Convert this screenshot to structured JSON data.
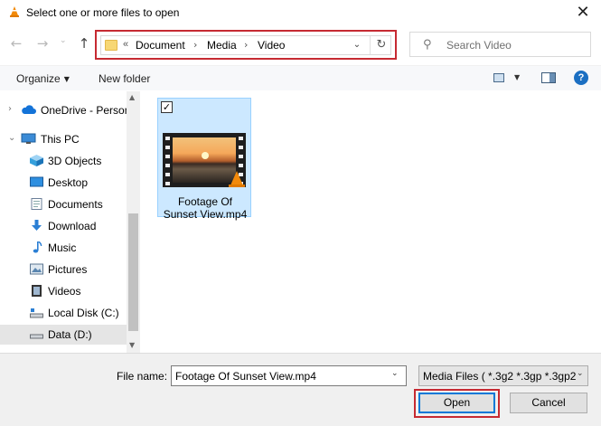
{
  "window": {
    "title": "Select one or more files to open",
    "close_glyph": "✕"
  },
  "nav": {
    "back": "←",
    "forward": "→",
    "recent": "⌄",
    "up": "↑"
  },
  "address": {
    "overflow": "«",
    "crumbs": [
      "Document",
      "Media",
      "Video"
    ],
    "separator": "›",
    "dropdown": "⌄",
    "refresh": "↻"
  },
  "search": {
    "placeholder": "Search Video",
    "icon": "⚲"
  },
  "toolbar": {
    "organize": "Organize",
    "new_folder": "New folder",
    "help": "?"
  },
  "sidebar": {
    "items": [
      {
        "label": "OneDrive - Person",
        "icon": "cloud-icon",
        "chevron": "›"
      },
      {
        "label": "This PC",
        "icon": "computer-icon",
        "chevron": "⌄"
      },
      {
        "label": "3D Objects",
        "icon": "cube-icon"
      },
      {
        "label": "Desktop",
        "icon": "desktop-icon"
      },
      {
        "label": "Documents",
        "icon": "documents-icon"
      },
      {
        "label": "Download",
        "icon": "download-icon"
      },
      {
        "label": "Music",
        "icon": "music-icon"
      },
      {
        "label": "Pictures",
        "icon": "pictures-icon"
      },
      {
        "label": "Videos",
        "icon": "videos-icon"
      },
      {
        "label": "Local Disk (C:)",
        "icon": "drive-icon"
      },
      {
        "label": "Data (D:)",
        "icon": "drive-icon",
        "selected": true
      }
    ]
  },
  "files": [
    {
      "name": "Footage Of Sunset View.mp4",
      "checked": true
    }
  ],
  "footer": {
    "file_name_label": "File name:",
    "file_name_value": "Footage Of Sunset View.mp4",
    "file_type_value": "Media Files ( *.3g2 *.3gp *.3gp2",
    "open": "Open",
    "cancel": "Cancel"
  },
  "colors": {
    "highlight": "#c62a32",
    "selection": "#cce8ff",
    "accent": "#0078d7"
  }
}
